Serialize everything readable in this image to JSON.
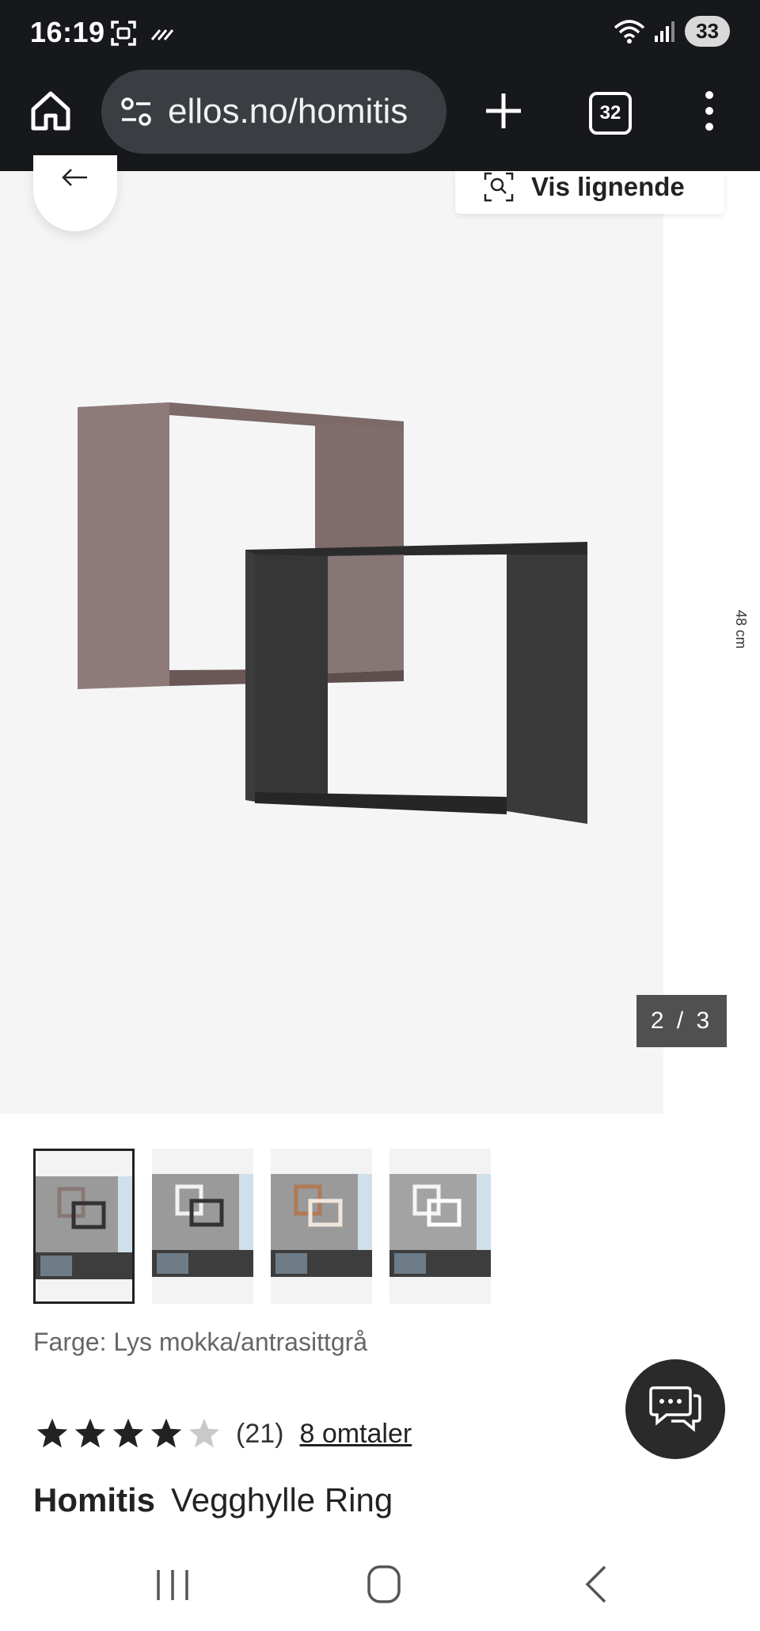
{
  "status_bar": {
    "time": "16:19",
    "battery": "33"
  },
  "browser": {
    "url": "ellos.no/homitis",
    "tab_count": "32"
  },
  "gallery": {
    "counter": "2 / 3",
    "similar_label": "Vis lignende",
    "side_peek_text": "48 cm"
  },
  "thumbnails": [
    {
      "name": "thumbnail-mokka-antrasitt",
      "active": true
    },
    {
      "name": "thumbnail-white-antrasitt",
      "active": false
    },
    {
      "name": "thumbnail-oak-white",
      "active": false
    },
    {
      "name": "thumbnail-white-white",
      "active": false
    }
  ],
  "product": {
    "color_line": "Farge: Lys mokka/antrasittgrå",
    "rating": 4,
    "rating_max": 5,
    "rating_count": "(21)",
    "reviews_link": "8 omtaler",
    "brand": "Homitis",
    "name": "Vegghylle Ring"
  },
  "colors": {
    "browser_bg": "#16181b",
    "shelf_mokka": "#8a7876",
    "shelf_antrasitt": "#3a3a3a"
  }
}
